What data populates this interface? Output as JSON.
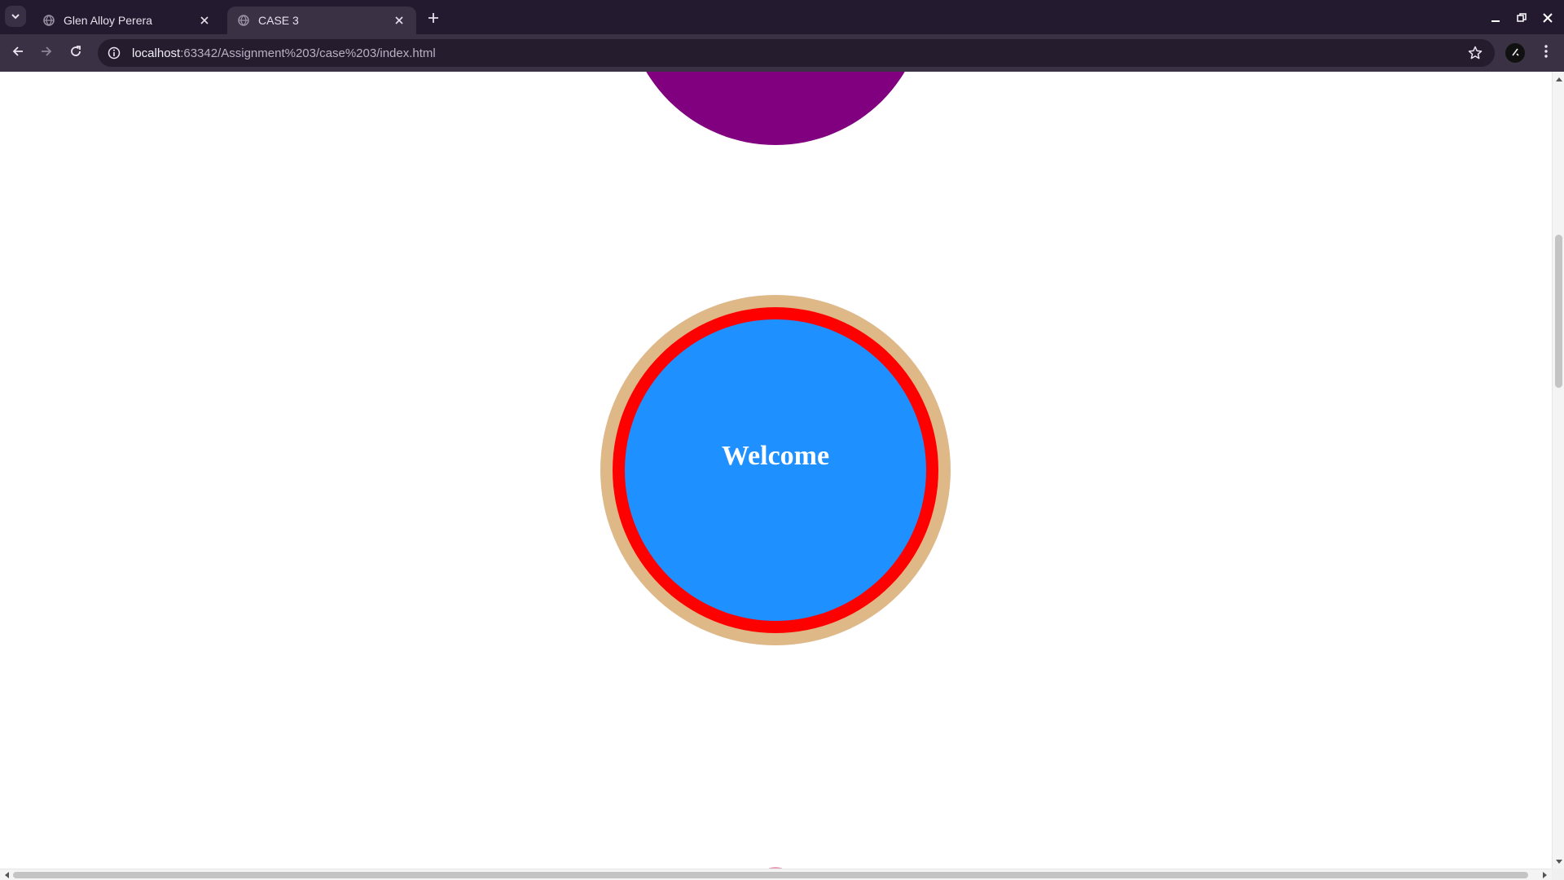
{
  "browser": {
    "tabs": [
      {
        "title": "Glen Alloy Perera",
        "active": false
      },
      {
        "title": "CASE 3",
        "active": true
      }
    ],
    "address": {
      "host": "localhost",
      "path": ":63342/Assignment%203/case%203/index.html"
    },
    "colors": {
      "frame": "#241a30",
      "toolbar": "#3b3145",
      "omnibox": "#251c2e"
    }
  },
  "page": {
    "welcome_text": "Welcome",
    "colors": {
      "top_circle": "#800080",
      "outer_ring": "#deb887",
      "middle_ring": "#ff0000",
      "inner_circle": "#1e90ff",
      "text": "#ffffff"
    }
  },
  "icons": {
    "tab_search": "chevron-down-icon",
    "favicon": "globe-icon",
    "close": "close-icon",
    "new_tab": "plus-icon",
    "back": "arrow-left-icon",
    "forward": "arrow-right-icon",
    "reload": "reload-icon",
    "info": "info-icon",
    "bookmark": "star-icon",
    "menu": "kebab-menu-icon"
  }
}
